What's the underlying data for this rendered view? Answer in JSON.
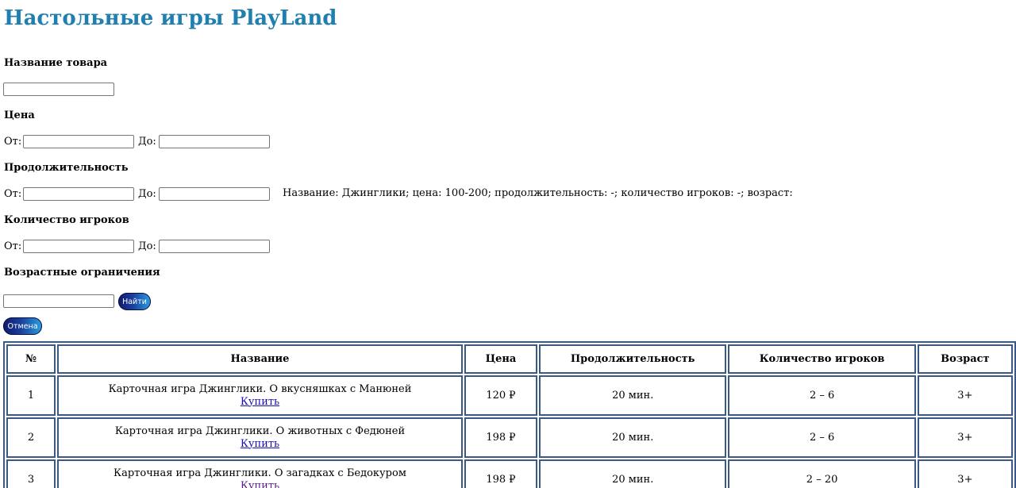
{
  "title": "Настольные игры PlayLand",
  "filters": {
    "name_label": "Название товара",
    "price_label": "Цена",
    "duration_label": "Продолжительность",
    "players_label": "Количество игроков",
    "age_label": "Возрастные ограничения",
    "from_label": "От:",
    "to_label": "До:",
    "name_value": "",
    "price_from": "",
    "price_to": "",
    "duration_from": "",
    "duration_to": "",
    "players_from": "",
    "players_to": "",
    "age_value": "",
    "search_button": "Найти",
    "cancel_button": "Отмена",
    "summary": "Название: Джинглики; цена: 100-200; продолжительность: -; количество игроков: -; возраст:"
  },
  "table": {
    "headers": [
      "№",
      "Название",
      "Цена",
      "Продолжительность",
      "Количество игроков",
      "Возраст"
    ],
    "buy_label": "Купить",
    "rows": [
      {
        "num": "1",
        "name": "Карточная игра Джинглики. О вкусняшках с Манюней",
        "price": "120 ₽",
        "duration": "20 мин.",
        "players": "2 – 6",
        "age": "3+"
      },
      {
        "num": "2",
        "name": "Карточная игра Джинглики. О животных с Федюней",
        "price": "198 ₽",
        "duration": "20 мин.",
        "players": "2 – 6",
        "age": "3+"
      },
      {
        "num": "3",
        "name": "Карточная игра Джинглики. О загадках с Бедокуром",
        "price": "198 ₽",
        "duration": "20 мин.",
        "players": "2 – 20",
        "age": "3+"
      }
    ]
  }
}
